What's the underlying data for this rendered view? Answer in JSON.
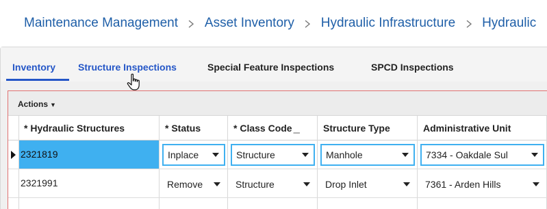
{
  "breadcrumb": {
    "items": [
      "Maintenance Management",
      "Asset Inventory",
      "Hydraulic Infrastructure",
      "Hydraulic"
    ]
  },
  "tabs": [
    {
      "label": "Inventory",
      "active": true
    },
    {
      "label": "Structure Inspections",
      "active": false
    },
    {
      "label": "Special Feature Inspections",
      "active": false
    },
    {
      "label": "SPCD Inspections",
      "active": false
    }
  ],
  "grid": {
    "actions_label": "Actions",
    "columns": [
      "* Hydraulic Structures",
      "* Status",
      "* Class Code",
      "Structure Type",
      "Administrative Unit"
    ],
    "rows": [
      {
        "id": "2321819",
        "status": "Inplace",
        "class_code": "Structure",
        "structure_type": "Manhole",
        "admin_unit": "7334 - Oakdale Sul",
        "selected": true
      },
      {
        "id": "2321991",
        "status": "Remove",
        "class_code": "Structure",
        "structure_type": "Drop Inlet",
        "admin_unit": "7361 - Arden Hills",
        "selected": false
      }
    ]
  },
  "colors": {
    "link": "#1f5fa8",
    "tab_active": "#2456c7",
    "selection": "#3fb0f0",
    "grid_border": "#e07070"
  }
}
